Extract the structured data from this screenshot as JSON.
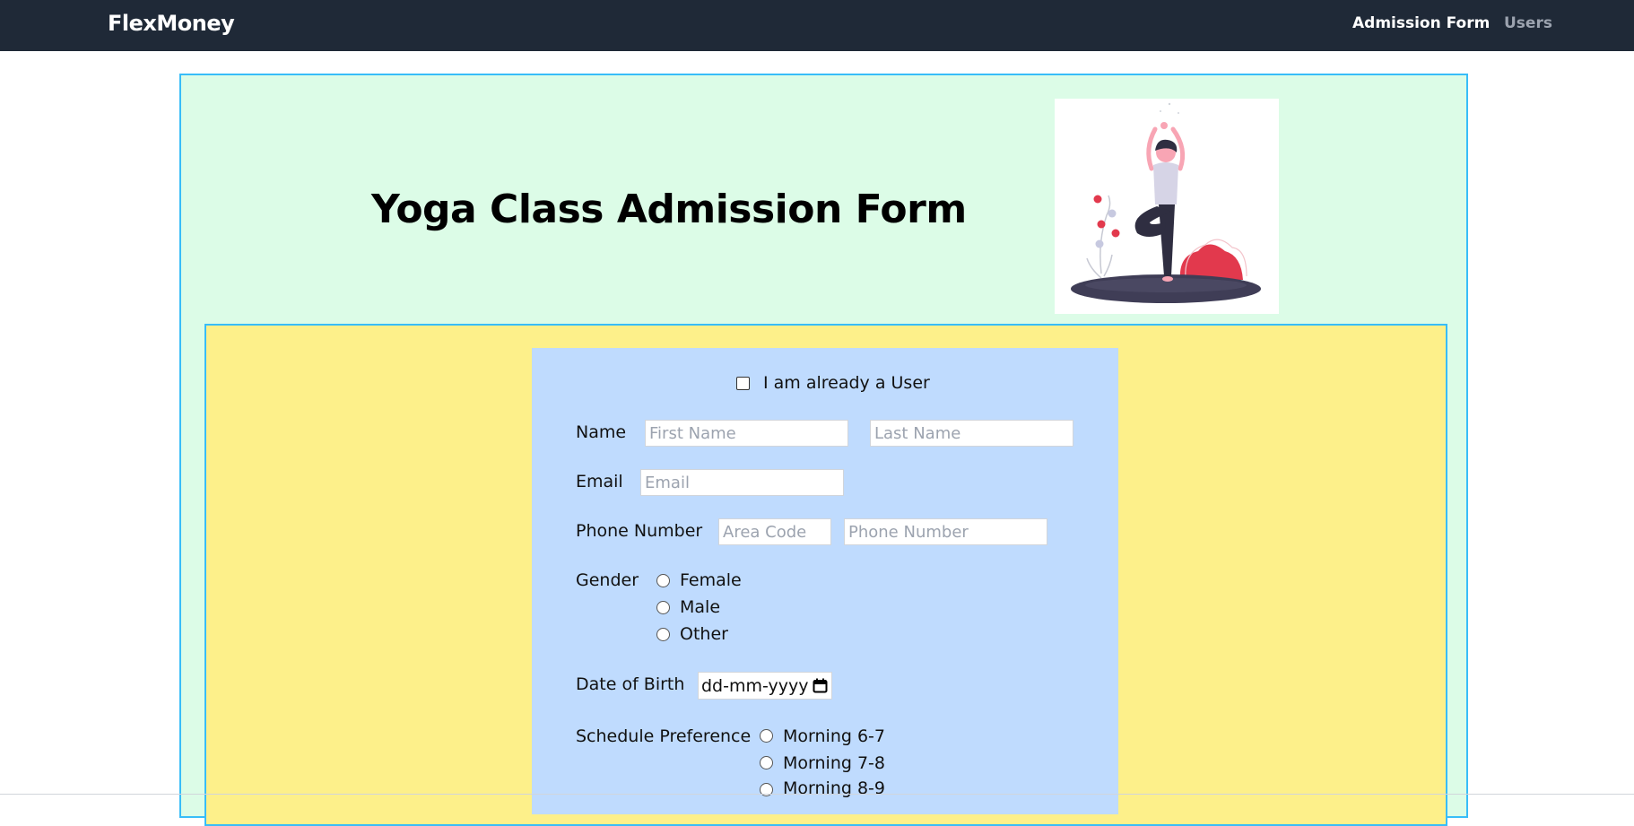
{
  "navbar": {
    "brand": "FlexMoney",
    "links": [
      {
        "label": "Admission Form",
        "active": true
      },
      {
        "label": "Users",
        "active": false
      }
    ]
  },
  "header": {
    "title": "Yoga Class Admission Form",
    "illustration": "woman-doing-tree-yoga-pose-illustration"
  },
  "form": {
    "existing_user_label": "I am already a User",
    "existing_user_checked": false,
    "name": {
      "label": "Name",
      "first_placeholder": "First Name",
      "last_placeholder": "Last Name"
    },
    "email": {
      "label": "Email",
      "placeholder": "Email"
    },
    "phone": {
      "label": "Phone Number",
      "area_placeholder": "Area Code",
      "number_placeholder": "Phone Number"
    },
    "gender": {
      "label": "Gender",
      "options": [
        "Female",
        "Male",
        "Other"
      ]
    },
    "dob": {
      "label": "Date of Birth",
      "placeholder": "dd-mm-yyyy"
    },
    "schedule": {
      "label": "Schedule Preference",
      "options": [
        "Morning 6-7",
        "Morning 7-8",
        "Morning 8-9"
      ]
    }
  },
  "colors": {
    "navbar": "#1f2937",
    "outer_panel": "#dcfce7",
    "yellow_panel": "#fdf08a",
    "form_card": "#bfdbfe",
    "panel_border": "#38bdf8"
  }
}
